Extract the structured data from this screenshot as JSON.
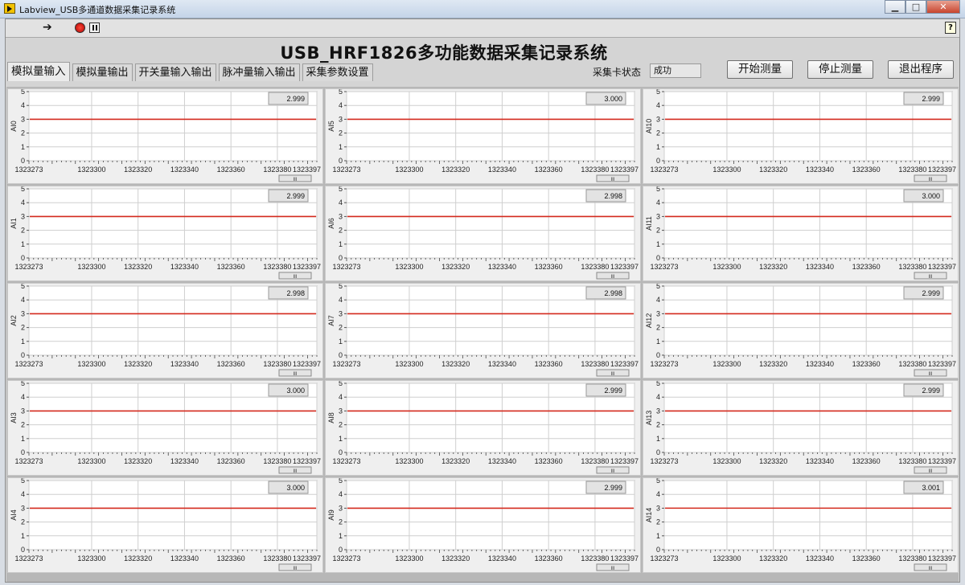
{
  "window": {
    "title": "Labview_USB多通道数据采集记录系统",
    "min_glyph": "▁",
    "max_glyph": "□",
    "close_glyph": "✕"
  },
  "toolbar": {
    "run_icon": "run-arrow-icon",
    "stop_icon": "abort-icon",
    "pause_icon": "pause-icon",
    "help_glyph": "?"
  },
  "header": {
    "title": "USB_HRF1826多功能数据采集记录系统",
    "tabs": [
      "模拟量输入",
      "模拟量输出",
      "开关量输入输出",
      "脉冲量输入输出",
      "采集参数设置"
    ],
    "active_tab": 0,
    "status_label": "采集卡状态",
    "status_value": "成功",
    "buttons": {
      "start": "开始测量",
      "stop": "停止测量",
      "exit": "退出程序"
    }
  },
  "colors": {
    "trace": "#d42a1e",
    "plot_bg": "#ffffff",
    "grid": "#cfcfcf"
  },
  "chart_data": [
    {
      "type": "line",
      "ylabel": "AI0",
      "value": "2.999",
      "y": 2.999
    },
    {
      "type": "line",
      "ylabel": "AI5",
      "value": "3.000",
      "y": 3.0
    },
    {
      "type": "line",
      "ylabel": "AI10",
      "value": "2.999",
      "y": 2.999
    },
    {
      "type": "line",
      "ylabel": "AI1",
      "value": "2.999",
      "y": 2.999
    },
    {
      "type": "line",
      "ylabel": "AI6",
      "value": "2.998",
      "y": 2.998
    },
    {
      "type": "line",
      "ylabel": "AI11",
      "value": "3.000",
      "y": 3.0
    },
    {
      "type": "line",
      "ylabel": "AI2",
      "value": "2.998",
      "y": 2.998
    },
    {
      "type": "line",
      "ylabel": "AI7",
      "value": "2.998",
      "y": 2.998
    },
    {
      "type": "line",
      "ylabel": "AI12",
      "value": "2.999",
      "y": 2.999
    },
    {
      "type": "line",
      "ylabel": "AI3",
      "value": "3.000",
      "y": 3.0
    },
    {
      "type": "line",
      "ylabel": "AI8",
      "value": "2.999",
      "y": 2.999
    },
    {
      "type": "line",
      "ylabel": "AI13",
      "value": "2.999",
      "y": 2.999
    },
    {
      "type": "line",
      "ylabel": "AI4",
      "value": "3.000",
      "y": 3.0
    },
    {
      "type": "line",
      "ylabel": "AI9",
      "value": "2.999",
      "y": 2.999
    },
    {
      "type": "line",
      "ylabel": "AI14",
      "value": "3.001",
      "y": 3.001
    }
  ],
  "chart_axes": {
    "xlim": [
      1323273,
      1323397
    ],
    "x_ticks": [
      "1323273",
      "1323300",
      "1323320",
      "1323340",
      "1323360",
      "1323380",
      "1323397"
    ],
    "x_tick_values": [
      1323273,
      1323300,
      1323320,
      1323340,
      1323360,
      1323380,
      1323397
    ],
    "ylim": [
      0,
      5
    ],
    "y_ticks": [
      0,
      1,
      2,
      3,
      4,
      5
    ],
    "grid": true,
    "scrollbar_glyph": "III"
  }
}
